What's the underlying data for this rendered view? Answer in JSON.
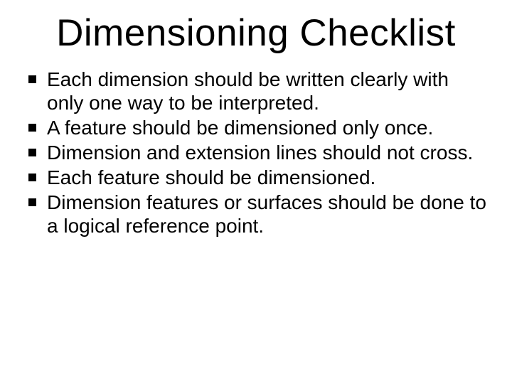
{
  "title": "Dimensioning Checklist",
  "bullets": [
    "Each dimension should be written clearly with only one way to be interpreted.",
    "A feature should be dimensioned only once.",
    "Dimension and extension lines should not cross.",
    "Each feature should be dimensioned.",
    "Dimension features or surfaces should be done to a logical reference point."
  ]
}
